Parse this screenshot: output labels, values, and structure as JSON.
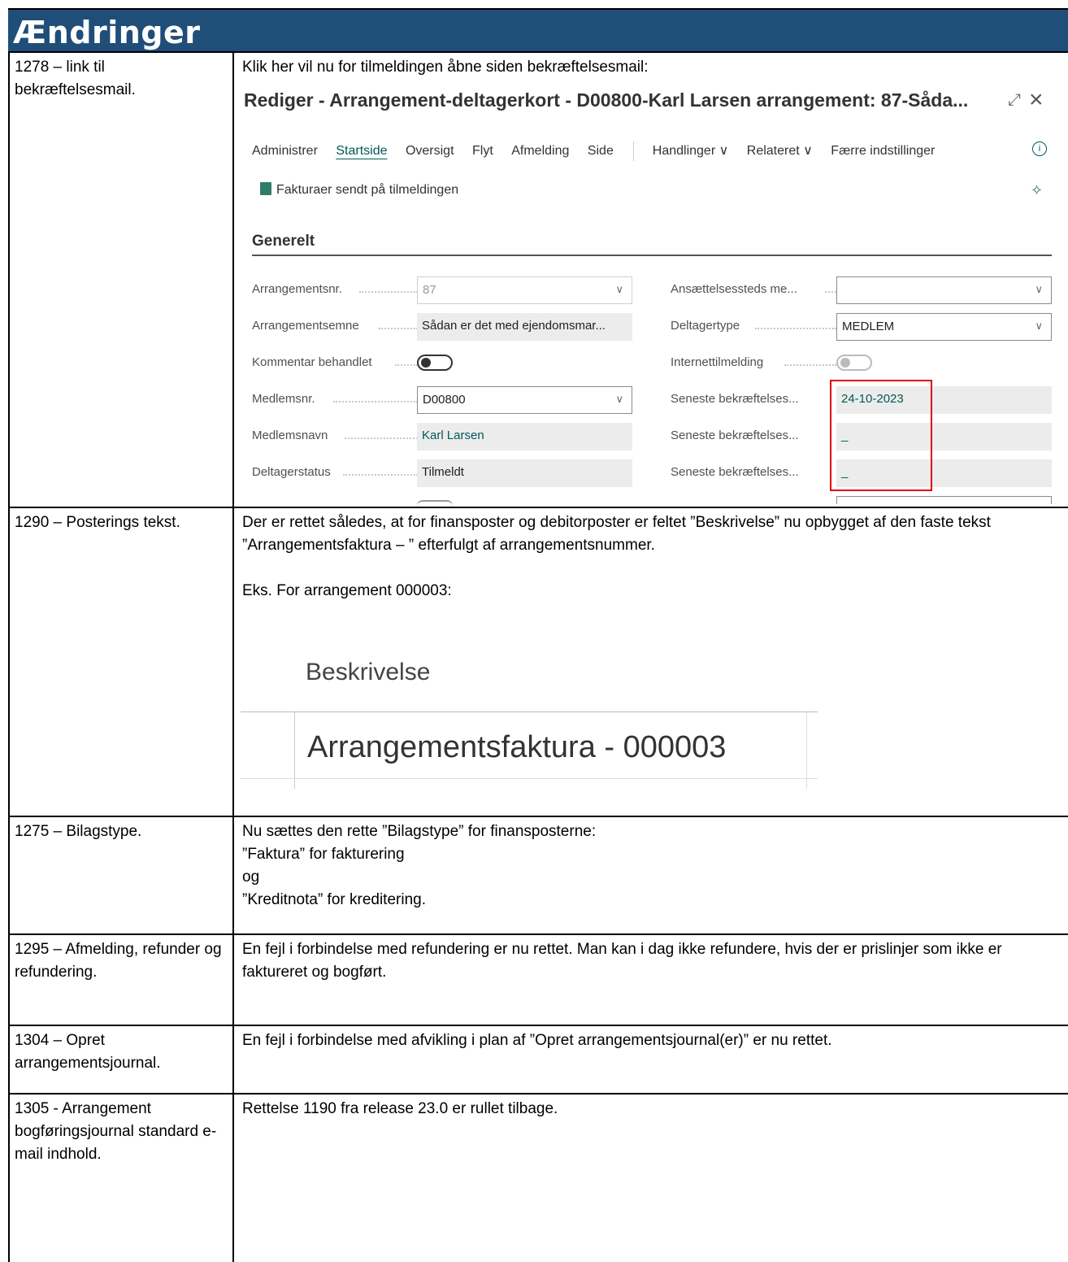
{
  "heading": "Ændringer",
  "rows": [
    {
      "id": "1278 – link til bekræftelsesmail.",
      "text": "Klik her vil nu for tilmeldingen åbne siden bekræftelsesmail:"
    },
    {
      "id": "1290 – Posterings tekst.",
      "text": "Der er rettet således, at for finansposter og debitorposter er feltet ”Beskrivelse” nu opbygget af den faste tekst ”Arrangementsfaktura – ” efterfulgt af arrangementsnummer.",
      "text2": "Eks. For arrangement 000003:"
    },
    {
      "id": "1275 – Bilagstype.",
      "lines": [
        "Nu sættes den rette ”Bilagstype” for finansposterne:",
        "”Faktura” for fakturering",
        "og",
        "”Kreditnota” for kreditering."
      ]
    },
    {
      "id": "1295 – Afmelding, refunder og refundering.",
      "text": "En fejl i forbindelse med refundering er nu rettet. Man kan i dag ikke refundere, hvis der er prislinjer som ikke er faktureret og bogført."
    },
    {
      "id": "1304 – Opret arrangementsjournal.",
      "text": "En fejl i forbindelse med afvikling i plan af ”Opret arrangementsjournal(er)” er nu rettet."
    },
    {
      "id": "1305 - Arrangement bogføringsjournal standard e-mail indhold.",
      "text": "Rettelse 1190 fra release 23.0 er rullet tilbage."
    }
  ],
  "card": {
    "title": "Rediger - Arrangement-deltagerkort - D00800-Karl Larsen arrangement: 87-Såda...",
    "menu": [
      "Administrer",
      "Startside",
      "Oversigt",
      "Flyt",
      "Afmelding",
      "Side"
    ],
    "menu_active": "Startside",
    "menu2": [
      "Handlinger ∨",
      "Relateret ∨",
      "Færre indstillinger"
    ],
    "action": "Fakturaer sendt på tilmeldingen",
    "section": "Generelt",
    "left_fields": [
      {
        "label": "Arrangementsnr.",
        "value": "87"
      },
      {
        "label": "Arrangementsemne",
        "value": "Sådan er det med ejendomsmar..."
      },
      {
        "label": "Kommentar behandlet",
        "value": ""
      },
      {
        "label": "Medlemsnr.",
        "value": "D00800"
      },
      {
        "label": "Medlemsnavn",
        "value": "Karl Larsen"
      },
      {
        "label": "Deltagerstatus",
        "value": "Tilmeldt"
      }
    ],
    "right_fields": [
      {
        "label": "Ansættelsessteds me...",
        "value": ""
      },
      {
        "label": "Deltagertype",
        "value": "MEDLEM"
      },
      {
        "label": "Internettilmelding",
        "value": ""
      },
      {
        "label": "Seneste bekræftelses...",
        "value": "24-10-2023"
      },
      {
        "label": "Seneste bekræftelses...",
        "value": "_"
      },
      {
        "label": "Seneste bekræftelses...",
        "value": "_"
      }
    ]
  },
  "beskrivelse": {
    "header": "Beskrivelse",
    "value": "Arrangementsfaktura - 000003"
  }
}
